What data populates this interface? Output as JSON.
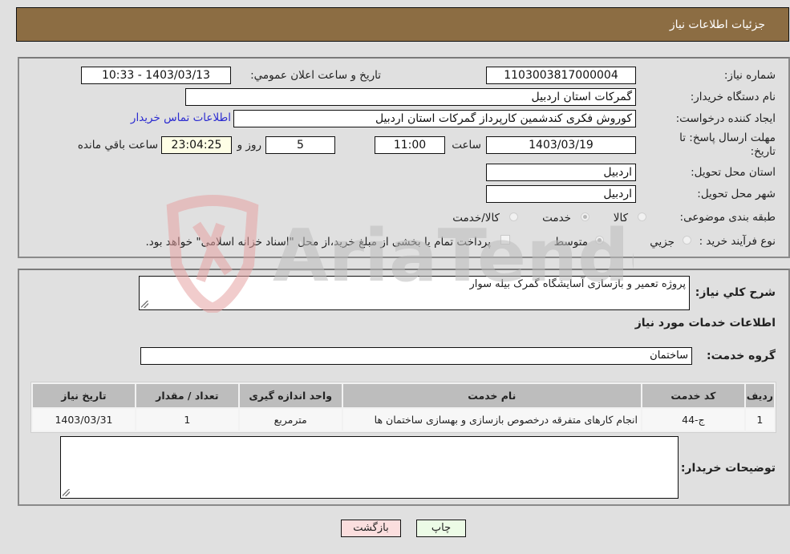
{
  "header": {
    "title": "جزئیات اطلاعات نیاز"
  },
  "details": {
    "need_number_label": "شماره نیاز:",
    "need_number": "1103003817000004",
    "announce_label": "تاریخ و ساعت اعلان عمومي:",
    "announce_value": "1403/03/13 - 10:33",
    "buyer_org_label": "نام دستگاه خریدار:",
    "buyer_org": "گمرکات استان اردبیل",
    "creator_label": "ایجاد کننده درخواست:",
    "creator": "کوروش فکری کندشمین کارپرداز گمرکات استان اردبیل",
    "contact_link": "اطلاعات تماس خریدار",
    "deadline_label": "مهلت ارسال پاسخ: تا تاریخ:",
    "deadline_date": "1403/03/19",
    "time_label": "ساعت",
    "deadline_time": "11:00",
    "days_value": "5",
    "days_label": "روز و",
    "remaining_time": "23:04:25",
    "remaining_label": "ساعت باقي مانده",
    "province_label": "استان محل تحویل:",
    "province": "اردبیل",
    "city_label": "شهر محل تحویل:",
    "city": "اردبیل",
    "category_label": "طبقه بندی موضوعی:",
    "category_options": [
      "کالا",
      "خدمت",
      "کالا/خدمت"
    ],
    "category_selected": "خدمت",
    "process_label": "نوع فرآیند خرید :",
    "process_options": [
      "جزيي",
      "متوسط"
    ],
    "process_selected": "متوسط",
    "treasury_note": "پرداخت تمام یا بخشی از مبلغ خرید،از محل \"اسناد خزانه اسلامی\" خواهد بود."
  },
  "services": {
    "description_label": "شرح کلي نیاز:",
    "description": "پروژه تعمیر و بازسازی آسایشگاه گمرک بیله سوار",
    "section_title": "اطلاعات خدمات مورد نیاز",
    "group_label": "گروه خدمت:",
    "group": "ساختمان",
    "table": {
      "headers": [
        "ردیف",
        "کد خدمت",
        "نام خدمت",
        "واحد اندازه گیری",
        "تعداد / مقدار",
        "تاریخ نیاز"
      ],
      "rows": [
        [
          "1",
          "ج-44",
          "انجام کارهای متفرقه درخصوص بازسازی و بهسازی ساختمان ها",
          "مترمربع",
          "1",
          "1403/03/31"
        ]
      ]
    },
    "buyer_notes_label": "توضیحات خریدار:",
    "buyer_notes": ""
  },
  "buttons": {
    "print": "چاپ",
    "back": "بازگشت"
  },
  "watermark": {
    "text": "AriaTender.neT"
  }
}
